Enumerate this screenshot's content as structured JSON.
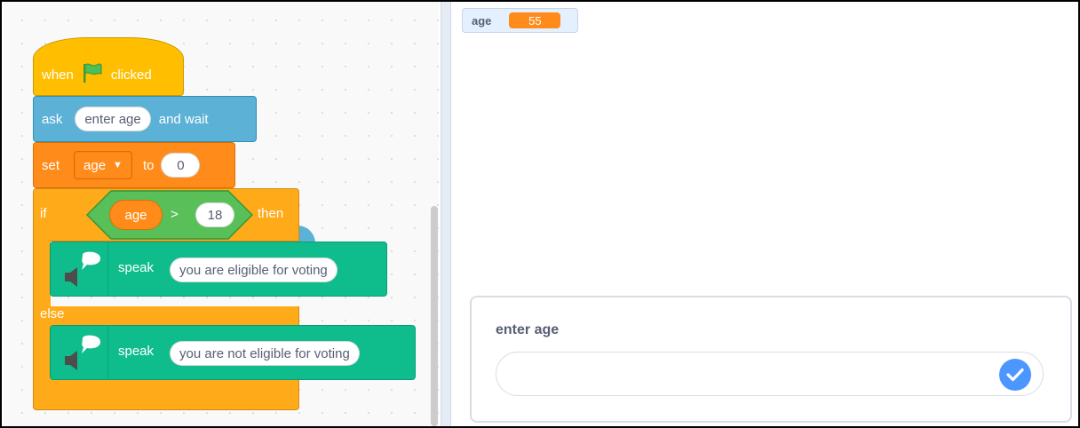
{
  "code": {
    "hat": {
      "before_flag": "when",
      "after_flag": "clicked",
      "flag_icon": "green-flag-icon"
    },
    "ask": {
      "keyword": "ask",
      "question": "enter age",
      "suffix": "and wait"
    },
    "set": {
      "keyword": "set",
      "variable": "age",
      "to": "to",
      "value": "0"
    },
    "if_else": {
      "if_label": "if",
      "condition": {
        "left": "age",
        "operator": ">",
        "right": "18"
      },
      "then_label": "then",
      "else_label": "else"
    },
    "speak_then": {
      "keyword": "speak",
      "text": "you are eligible for voting",
      "icon": "speech-bubble-speaker-icon"
    },
    "speak_else": {
      "keyword": "speak",
      "text": "you are not eligible for voting",
      "icon": "speech-bubble-speaker-icon"
    }
  },
  "stage": {
    "monitor": {
      "name": "age",
      "value": "55"
    },
    "ask_dialog": {
      "question": "enter age",
      "input_value": "",
      "submit_icon": "check-icon"
    }
  },
  "colors": {
    "events": "#ffbf00",
    "sensing": "#5cb1d6",
    "variables": "#ff8c1a",
    "control": "#ffab19",
    "operators": "#59c059",
    "extension": "#0fbd8c",
    "accent": "#4c97ff"
  }
}
